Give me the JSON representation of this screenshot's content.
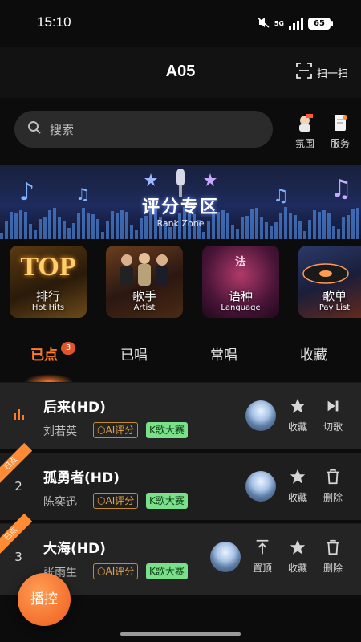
{
  "status_bar": {
    "time": "15:10",
    "network": "5G",
    "battery": "65"
  },
  "header": {
    "title": "A05",
    "scan_label": "扫一扫"
  },
  "search": {
    "placeholder": "搜索"
  },
  "quick_actions": [
    {
      "label": "氛围",
      "icon": "atmosphere-icon"
    },
    {
      "label": "服务",
      "icon": "service-icon"
    }
  ],
  "banner": {
    "title": "评分专区",
    "subtitle": "Rank Zone"
  },
  "categories": [
    {
      "label": "排行",
      "sub": "Hot Hits",
      "art": "TOP"
    },
    {
      "label": "歌手",
      "sub": "Artist",
      "art": ""
    },
    {
      "label": "语种",
      "sub": "Language",
      "art": "法"
    },
    {
      "label": "歌单",
      "sub": "Pay List",
      "art": ""
    }
  ],
  "tabs": [
    {
      "label": "已点",
      "badge": "3",
      "active": true
    },
    {
      "label": "已唱",
      "active": false
    },
    {
      "label": "常唱",
      "active": false
    },
    {
      "label": "收藏",
      "active": false
    }
  ],
  "songs": [
    {
      "index": "",
      "playing": true,
      "title": "后来(HD)",
      "artist": "刘若英",
      "tag_ai": "AI评分",
      "tag_k": "K歌大赛",
      "ribbon": "",
      "actions": [
        {
          "label": "收藏",
          "icon": "star-icon"
        },
        {
          "label": "切歌",
          "icon": "next-track-icon"
        }
      ]
    },
    {
      "index": "2",
      "playing": false,
      "title": "孤勇者(HD)",
      "artist": "陈奕迅",
      "tag_ai": "AI评分",
      "tag_k": "K歌大赛",
      "ribbon": "已点",
      "actions": [
        {
          "label": "收藏",
          "icon": "star-icon"
        },
        {
          "label": "删除",
          "icon": "trash-icon"
        }
      ]
    },
    {
      "index": "3",
      "playing": false,
      "title": "大海(HD)",
      "artist": "张雨生",
      "tag_ai": "AI评分",
      "tag_k": "K歌大赛",
      "ribbon": "已点",
      "actions": [
        {
          "label": "置顶",
          "icon": "pin-top-icon"
        },
        {
          "label": "收藏",
          "icon": "star-icon"
        },
        {
          "label": "删除",
          "icon": "trash-icon"
        }
      ]
    }
  ],
  "fab": {
    "label": "播控"
  },
  "colors": {
    "accent": "#ff7a2a",
    "badge": "#e0552a",
    "tag_k_bg": "#7be08a",
    "tag_ai": "#e2a24a",
    "row_bg": "#242424"
  }
}
